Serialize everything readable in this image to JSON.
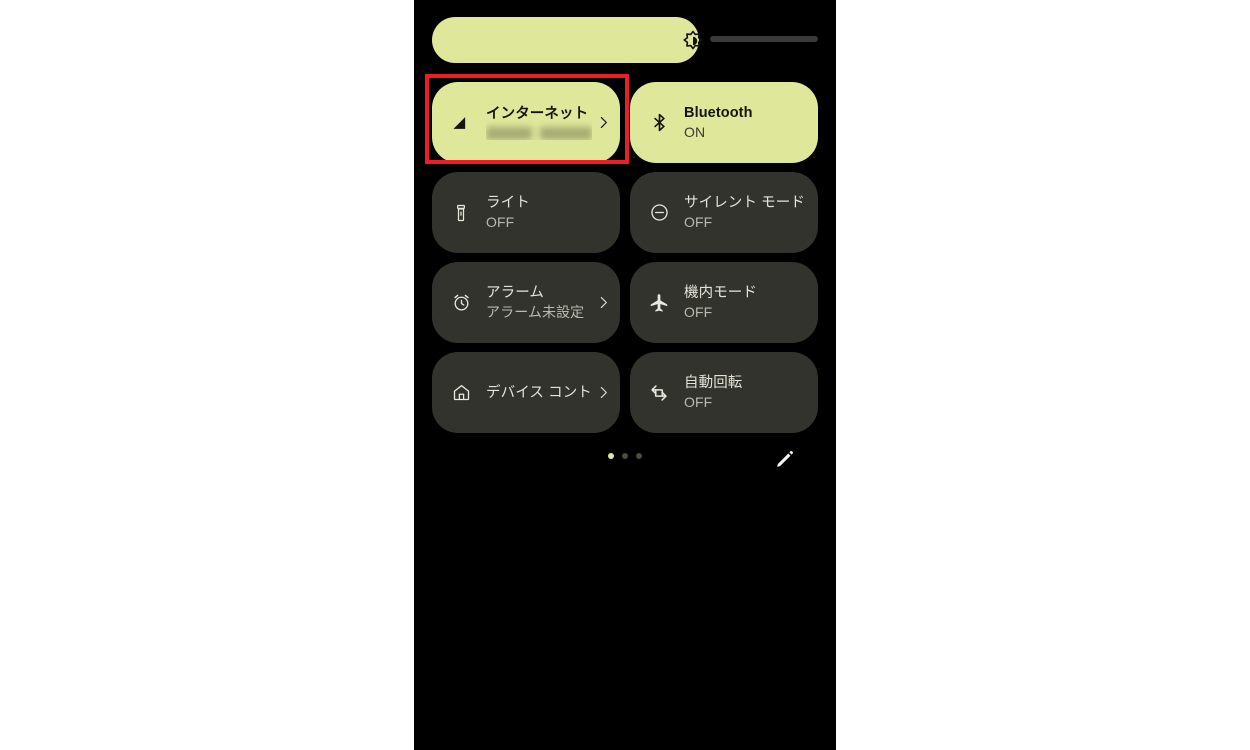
{
  "screen": {
    "background_color": "#000000",
    "accent_color": "#dfe79b",
    "tile_inactive_color": "#32332c",
    "highlight_color": "#ee1c24"
  },
  "brightness": {
    "name": "brightness-slider",
    "icon": "brightness-icon",
    "value_percent": 69
  },
  "tiles": [
    {
      "id": "internet",
      "icon": "signal-cellular-icon",
      "title": "インターネット",
      "subtitle": "",
      "subtitle_redacted": true,
      "state": "active",
      "has_chevron": true
    },
    {
      "id": "bluetooth",
      "icon": "bluetooth-icon",
      "title": "Bluetooth",
      "subtitle": "ON",
      "subtitle_redacted": false,
      "state": "active",
      "has_chevron": false
    },
    {
      "id": "flashlight",
      "icon": "flashlight-icon",
      "title": "ライト",
      "subtitle": "OFF",
      "subtitle_redacted": false,
      "state": "inactive",
      "has_chevron": false
    },
    {
      "id": "silent-mode",
      "icon": "do-not-disturb-icon",
      "title": "サイレント モード",
      "subtitle": "OFF",
      "subtitle_redacted": false,
      "state": "inactive",
      "has_chevron": false
    },
    {
      "id": "alarm",
      "icon": "alarm-clock-icon",
      "title": "アラーム",
      "subtitle": "アラーム未設定",
      "subtitle_redacted": false,
      "state": "inactive",
      "has_chevron": true
    },
    {
      "id": "airplane-mode",
      "icon": "airplane-icon",
      "title": "機内モード",
      "subtitle": "OFF",
      "subtitle_redacted": false,
      "state": "inactive",
      "has_chevron": false
    },
    {
      "id": "device-controls",
      "icon": "home-icon",
      "title": "デバイス コント",
      "subtitle": "",
      "subtitle_redacted": false,
      "state": "inactive",
      "has_chevron": true
    },
    {
      "id": "auto-rotate",
      "icon": "auto-rotate-icon",
      "title": "自動回転",
      "subtitle": "OFF",
      "subtitle_redacted": false,
      "state": "inactive",
      "has_chevron": false
    }
  ],
  "footer": {
    "page_dots": {
      "total": 3,
      "active_index": 0
    },
    "edit_button_icon": "pencil-icon"
  }
}
